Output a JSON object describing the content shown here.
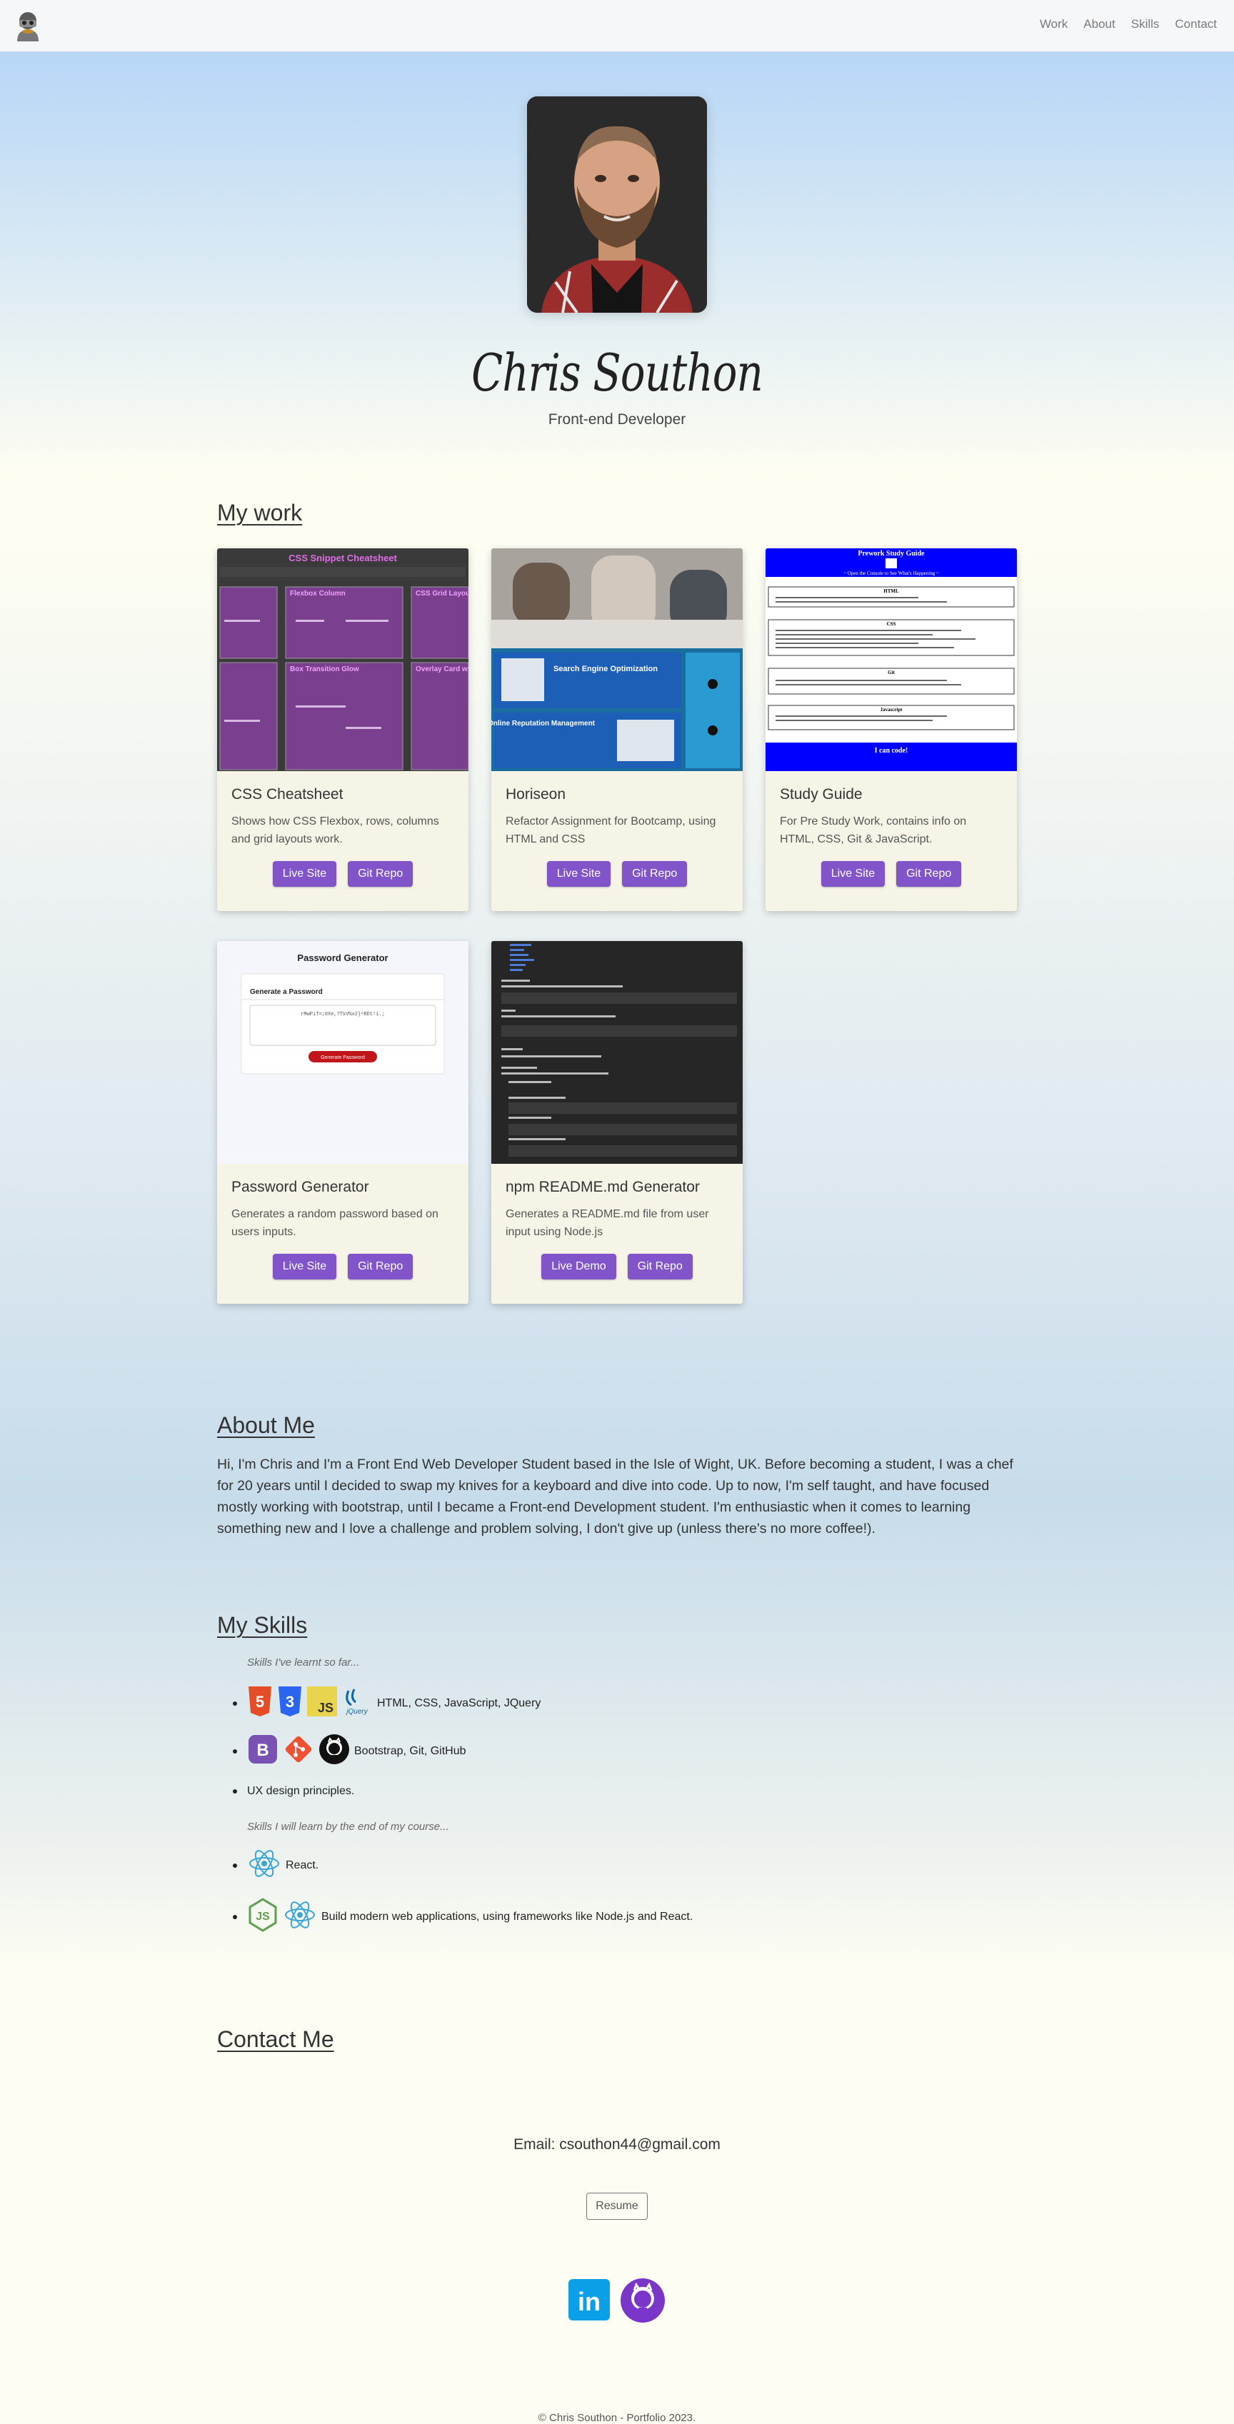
{
  "nav": {
    "links": [
      "Work",
      "About",
      "Skills",
      "Contact"
    ]
  },
  "hero": {
    "name": "Chris Southon",
    "role": "Front-end Developer"
  },
  "work": {
    "title": "My work",
    "projects": [
      {
        "title": "CSS Cheatsheet",
        "desc": "Shows how CSS Flexbox, rows, columns and grid layouts work.",
        "btn1": "Live Site",
        "btn2": "Git Repo"
      },
      {
        "title": "Horiseon",
        "desc": "Refactor Assignment for Bootcamp, using HTML and CSS",
        "btn1": "Live Site",
        "btn2": "Git Repo"
      },
      {
        "title": "Study Guide",
        "desc": "For Pre Study Work, contains info on HTML, CSS, Git & JavaScript.",
        "btn1": "Live Site",
        "btn2": "Git Repo"
      },
      {
        "title": "Password Generator",
        "desc": "Generates a random password based on users inputs.",
        "btn1": "Live Site",
        "btn2": "Git Repo"
      },
      {
        "title": "npm README.md Generator",
        "desc": "Generates a README.md file from user input using Node.js",
        "btn1": "Live Demo",
        "btn2": "Git Repo"
      }
    ],
    "thumbs": {
      "css_title": "CSS Snippet Cheatsheet",
      "css_boxes": [
        "Flexbox Column",
        "CSS Grid Layout",
        "Box Transition Glow",
        "Overlay Card wit"
      ],
      "horiseon_seo": "Search Engine Optimization",
      "horiseon_orm": "Online Reputation Management",
      "study_title": "Prework Study Guide",
      "study_sub": "~ Open the Console to See What's Happening ~",
      "study_sections": [
        "HTML",
        "CSS",
        "Git",
        "Javascript"
      ],
      "study_footer": "I can code!",
      "pw_title": "Password Generator",
      "pw_card": "Generate a Password",
      "pw_value": "rMwPiT=;0Xe,?TkV%x2}^RDt!i.;",
      "pw_button": "Generate Password"
    }
  },
  "about": {
    "title": "About Me",
    "text": "Hi, I'm Chris and I'm a Front End Web Developer Student based in the Isle of Wight, UK. Before becoming a student, I was a chef for 20 years until I decided to swap my knives for a keyboard and dive into code. Up to now, I'm self taught, and have focused mostly working with bootstrap, until I became a Front-end Development student. I'm enthusiastic when it comes to learning something new and I love a challenge and problem solving, I don't give up (unless there's no more coffee!)."
  },
  "skills": {
    "title": "My Skills",
    "note1": "Skills I've learnt so far...",
    "row1": "HTML, CSS, JavaScript, JQuery",
    "row2": "Bootstrap, Git, GitHub",
    "row3": "UX design principles.",
    "note2": "Skills I will learn by the end of my course...",
    "row4": "React.",
    "row5": "Build modern web applications, using frameworks like Node.js and React.",
    "icons": {
      "html": "5",
      "css": "3",
      "js": "JS",
      "jquery": "jQuery",
      "bootstrap": "B"
    }
  },
  "contact": {
    "title": "Contact Me",
    "email": "Email: csouthon44@gmail.com",
    "resume": "Resume",
    "linkedin": "in"
  },
  "footer": {
    "text": "© Chris Southon - Portfolio 2023."
  },
  "colors": {
    "button": "#8155c9",
    "linkedin": "#0a9fe6",
    "github": "#7a35c9"
  }
}
